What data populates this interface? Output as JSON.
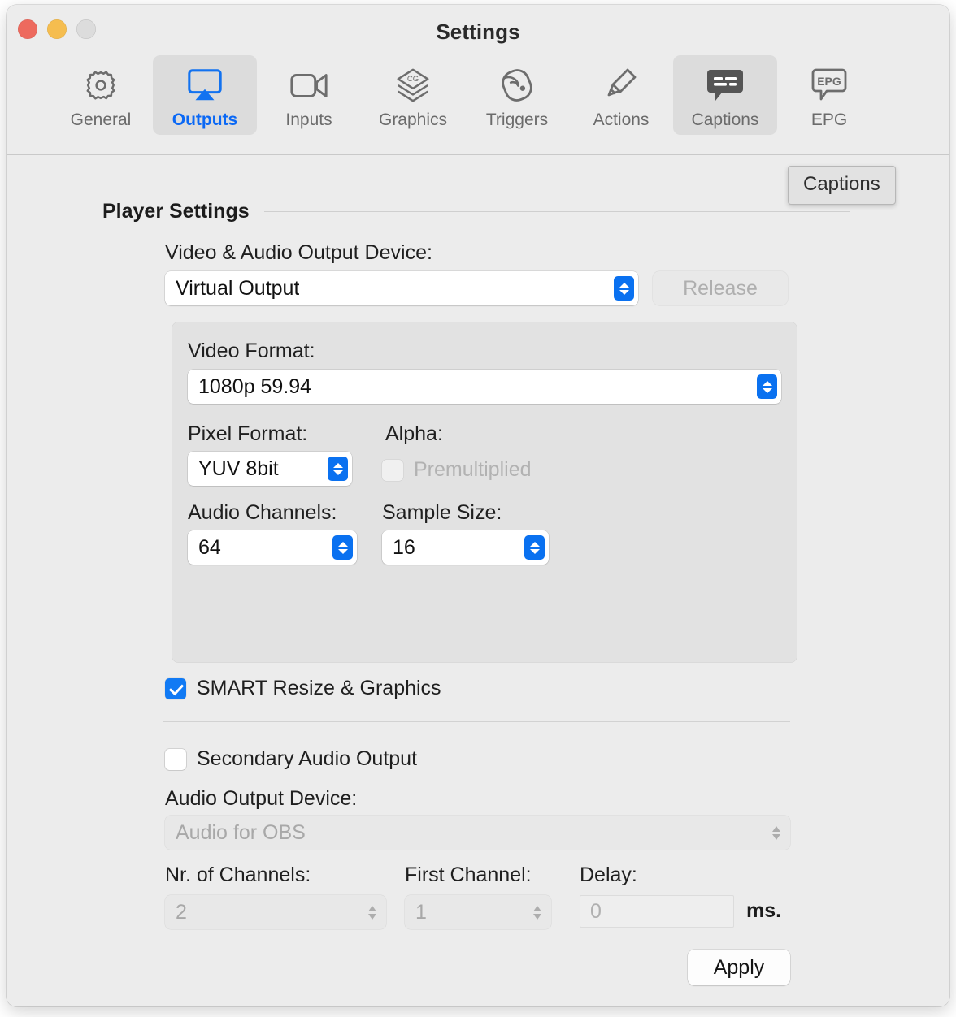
{
  "window": {
    "title": "Settings",
    "traffic_lights": [
      "close-button",
      "minimize-button",
      "zoom-button"
    ]
  },
  "toolbar": {
    "items": [
      {
        "label": "General",
        "icon": "gear-icon",
        "selected": false,
        "active": false
      },
      {
        "label": "Outputs",
        "icon": "airplay-icon",
        "selected": true,
        "active": true
      },
      {
        "label": "Inputs",
        "icon": "video-camera-icon",
        "selected": false,
        "active": false
      },
      {
        "label": "Graphics",
        "icon": "layers-cg-icon",
        "selected": false,
        "active": false
      },
      {
        "label": "Triggers",
        "icon": "signal-disc-icon",
        "selected": false,
        "active": false
      },
      {
        "label": "Actions",
        "icon": "paint-roller-icon",
        "selected": false,
        "active": false
      },
      {
        "label": "Captions",
        "icon": "caption-bubble-icon",
        "selected": true,
        "active": false
      },
      {
        "label": "EPG",
        "icon": "epg-bubble-icon",
        "selected": false,
        "active": false
      }
    ]
  },
  "tooltip": {
    "text": "Captions"
  },
  "main": {
    "section_title": "Player Settings",
    "video_audio_output_device": {
      "label": "Video & Audio Output Device:",
      "value": "Virtual Output",
      "release_button": "Release",
      "release_disabled": true
    },
    "group": {
      "video_format": {
        "label": "Video Format:",
        "value": "1080p 59.94"
      },
      "pixel_format": {
        "label": "Pixel Format:",
        "value": "YUV 8bit"
      },
      "alpha": {
        "label": "Alpha:",
        "checkbox_label": "Premultiplied",
        "checked": false,
        "disabled": true
      },
      "audio_channels": {
        "label": "Audio Channels:",
        "value": "64"
      },
      "sample_size": {
        "label": "Sample Size:",
        "value": "16"
      }
    },
    "smart_resize": {
      "label": "SMART Resize & Graphics",
      "checked": true
    },
    "secondary_audio_output": {
      "label": "Secondary Audio Output",
      "checked": false
    },
    "audio_output_device": {
      "label": "Audio Output Device:",
      "value": "Audio for OBS",
      "disabled": true
    },
    "nr_of_channels": {
      "label": "Nr. of Channels:",
      "value": "2",
      "disabled": true
    },
    "first_channel": {
      "label": "First Channel:",
      "value": "1",
      "disabled": true
    },
    "delay": {
      "label": "Delay:",
      "value": "0",
      "unit": "ms.",
      "disabled": true
    },
    "apply_button": "Apply"
  },
  "colors": {
    "accent_blue": "#0a71f4",
    "window_bg": "#ececec",
    "group_bg": "#e2e2e2",
    "traffic_red": "#ed6a5e",
    "traffic_yellow": "#f5bd4f",
    "traffic_gray": "#dcdcdc"
  }
}
